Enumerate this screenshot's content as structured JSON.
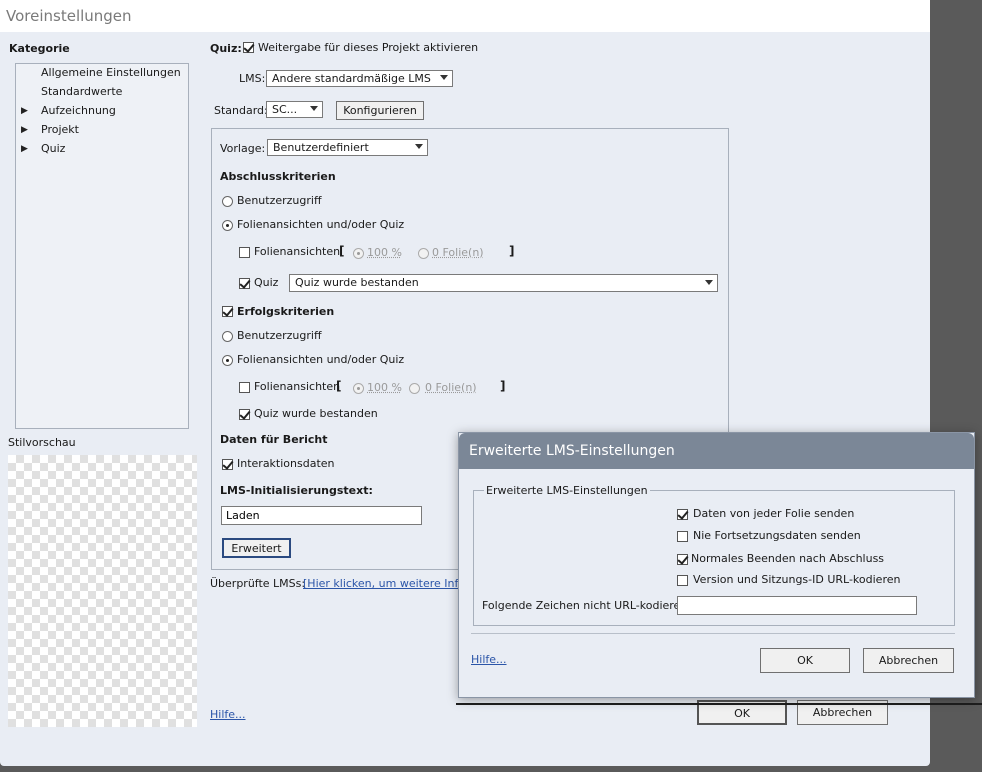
{
  "window": {
    "title": "Voreinstellungen"
  },
  "sidebar": {
    "heading": "Kategorie",
    "items": [
      {
        "label": "Allgemeine Einstellungen",
        "expandable": false
      },
      {
        "label": "Standardwerte",
        "expandable": false
      },
      {
        "label": "Aufzeichnung",
        "expandable": true
      },
      {
        "label": "Projekt",
        "expandable": true
      },
      {
        "label": "Quiz",
        "expandable": true
      }
    ],
    "preview_label": "Stilvorschau"
  },
  "quiz": {
    "label": "Quiz:",
    "enable_label": "Weitergabe für dieses Projekt aktivieren",
    "enable_checked": true,
    "lms_label": "LMS:",
    "lms_value": "Andere standardmäßige LMS",
    "standard_label": "Standard:",
    "standard_value": "SC...",
    "configure_label": "Konfigurieren"
  },
  "template": {
    "label": "Vorlage:",
    "value": "Benutzerdefiniert"
  },
  "completion": {
    "heading": "Abschlusskriterien",
    "user_access": "Benutzerzugriff",
    "slides_or_quiz": "Folienansichten und/oder Quiz",
    "slide_views": "Folienansichten",
    "bracket_open": "[",
    "bracket_close": "]",
    "percent": "100 %",
    "slides": "0 Folie(n)",
    "quiz_label": "Quiz",
    "quiz_value": "Quiz wurde bestanden"
  },
  "success": {
    "heading": "Erfolgskriterien",
    "user_access": "Benutzerzugriff",
    "slides_or_quiz": "Folienansichten und/oder Quiz",
    "slide_views": "Folienansichten",
    "bracket_open": "[",
    "bracket_close": "]",
    "percent": "100 %",
    "slides": "0 Folie(n)",
    "quiz_passed": "Quiz wurde bestanden"
  },
  "report": {
    "heading": "Daten für Bericht",
    "interaction_data": "Interaktionsdaten"
  },
  "init_text": {
    "heading": "LMS-Initialisierungstext:",
    "value": "Laden"
  },
  "advanced_button": "Erweitert",
  "checked_lms": {
    "label": "Überprüfte LMSs:",
    "link": "[Hier klicken, um weitere Infor"
  },
  "footer": {
    "help": "Hilfe...",
    "ok": "OK",
    "cancel": "Abbrechen"
  },
  "dialog": {
    "title": "Erweiterte LMS-Einstellungen",
    "group_label": "Erweiterte LMS-Einstellungen",
    "options": [
      {
        "label": "Daten von jeder Folie senden",
        "checked": true
      },
      {
        "label": "Nie Fortsetzungsdaten senden",
        "checked": false
      },
      {
        "label": "Normales Beenden nach Abschluss",
        "checked": true
      },
      {
        "label": "Version und Sitzungs-ID URL-kodieren",
        "checked": false
      }
    ],
    "no_encode_label": "Folgende Zeichen nicht URL-kodieren:",
    "no_encode_value": "",
    "help": "Hilfe...",
    "ok": "OK",
    "cancel": "Abbrechen"
  }
}
